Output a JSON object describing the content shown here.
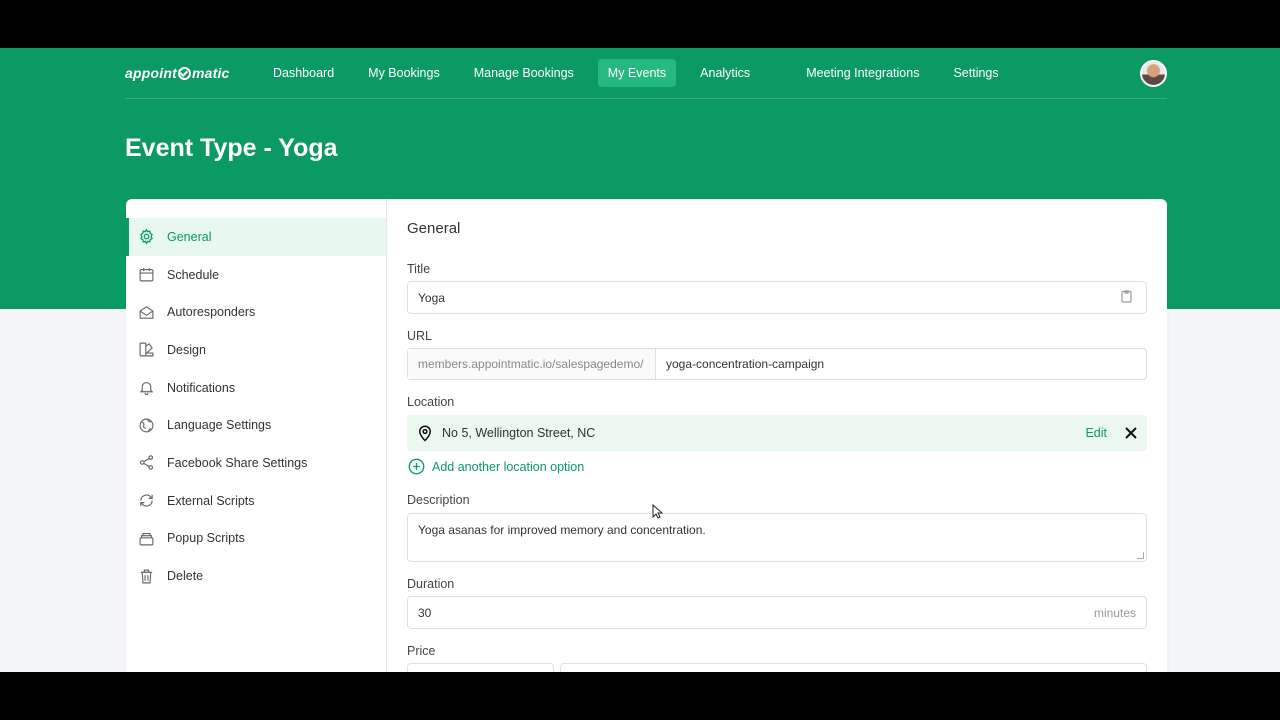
{
  "app": {
    "logo_left": "appoint",
    "logo_right": "matic"
  },
  "nav": {
    "items": [
      {
        "label": "Dashboard"
      },
      {
        "label": "My Bookings"
      },
      {
        "label": "Manage Bookings"
      },
      {
        "label": "My Events",
        "active": true
      },
      {
        "label": "Analytics"
      },
      {
        "label": "Meeting Integrations"
      },
      {
        "label": "Settings"
      }
    ]
  },
  "page": {
    "title": "Event Type - Yoga"
  },
  "sidebar": {
    "items": [
      {
        "label": "General",
        "icon": "gear-icon",
        "active": true
      },
      {
        "label": "Schedule",
        "icon": "calendar-icon"
      },
      {
        "label": "Autoresponders",
        "icon": "envelope-icon"
      },
      {
        "label": "Design",
        "icon": "palette-icon"
      },
      {
        "label": "Notifications",
        "icon": "bell-icon"
      },
      {
        "label": "Language Settings",
        "icon": "globe-icon"
      },
      {
        "label": "Facebook Share Settings",
        "icon": "share-icon"
      },
      {
        "label": "External Scripts",
        "icon": "refresh-icon"
      },
      {
        "label": "Popup Scripts",
        "icon": "stack-icon"
      },
      {
        "label": "Delete",
        "icon": "trash-icon"
      }
    ]
  },
  "form": {
    "section_title": "General",
    "title_label": "Title",
    "title_value": "Yoga",
    "url_label": "URL",
    "url_prefix": "members.appointmatic.io/salespagedemo/",
    "url_slug": "yoga-concentration-campaign",
    "location_label": "Location",
    "location_value": "No 5, Wellington Street, NC",
    "location_edit": "Edit",
    "add_location": "Add another location option",
    "description_label": "Description",
    "description_value": "Yoga asanas for improved memory and concentration.",
    "duration_label": "Duration",
    "duration_value": "30",
    "duration_suffix": "minutes",
    "price_label": "Price"
  },
  "colors": {
    "brand": "#0b9a63",
    "active_nav": "#26b97f",
    "active_side_bg": "#e8f7ef"
  }
}
